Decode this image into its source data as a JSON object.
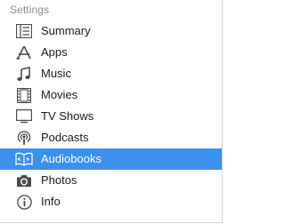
{
  "sidebar": {
    "section_title": "Settings",
    "items": [
      {
        "label": "Summary",
        "icon": "summary-icon",
        "selected": false
      },
      {
        "label": "Apps",
        "icon": "apps-icon",
        "selected": false
      },
      {
        "label": "Music",
        "icon": "music-note-icon",
        "selected": false
      },
      {
        "label": "Movies",
        "icon": "film-strip-icon",
        "selected": false
      },
      {
        "label": "TV Shows",
        "icon": "tv-icon",
        "selected": false
      },
      {
        "label": "Podcasts",
        "icon": "podcast-icon",
        "selected": false
      },
      {
        "label": "Audiobooks",
        "icon": "audiobook-icon",
        "selected": true
      },
      {
        "label": "Photos",
        "icon": "camera-icon",
        "selected": false
      },
      {
        "label": "Info",
        "icon": "info-icon",
        "selected": false
      }
    ]
  },
  "colors": {
    "selection": "#3d8ff0",
    "icon": "#4a4a4a",
    "selected_icon": "#ffffff",
    "header_text": "#8a8a8a"
  }
}
